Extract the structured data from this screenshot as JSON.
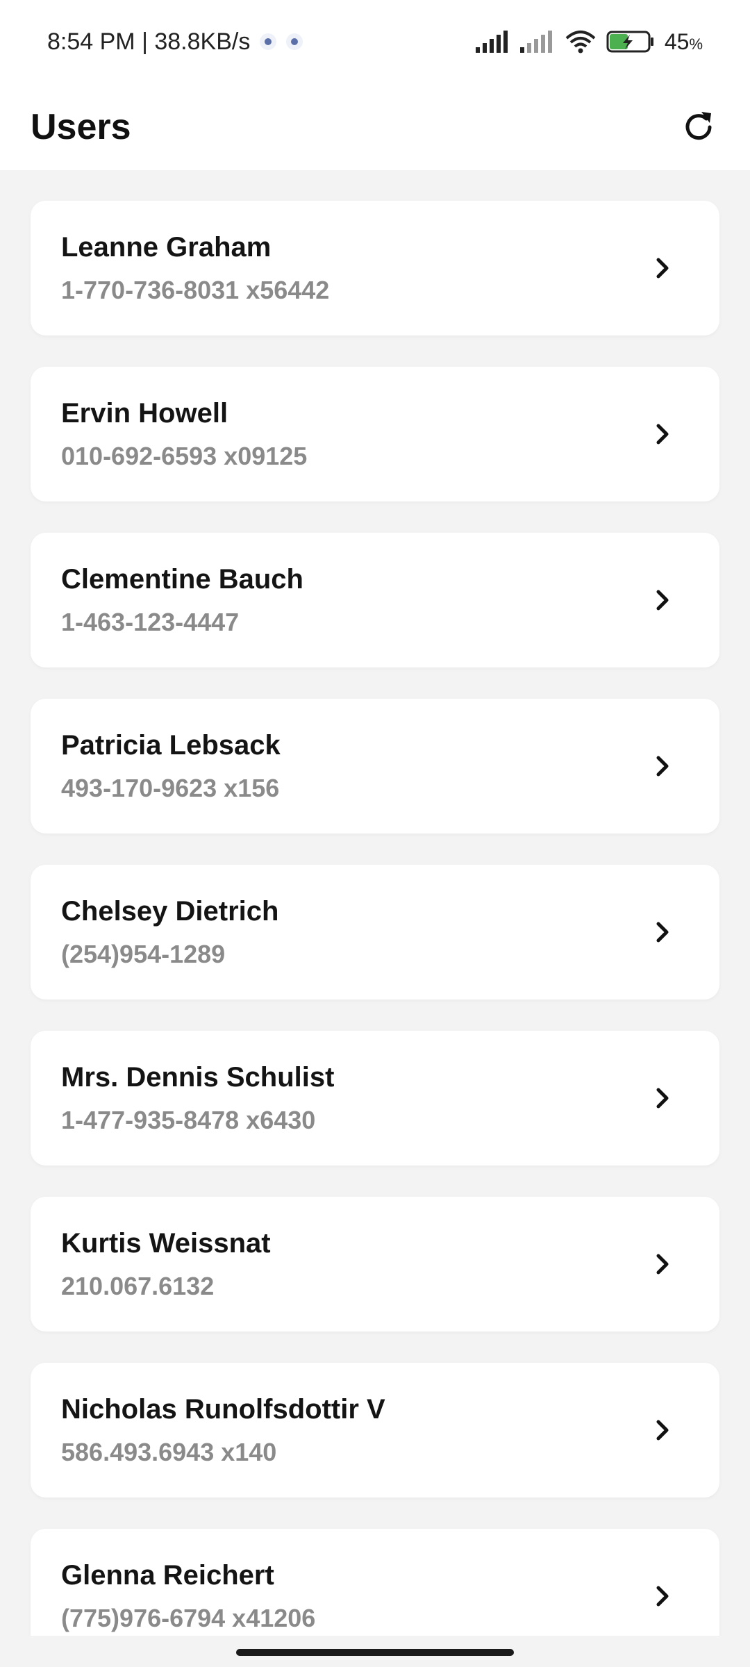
{
  "status_bar": {
    "time_speed": "8:54 PM | 38.8KB/s",
    "battery": "45"
  },
  "app_bar": {
    "title": "Users"
  },
  "users": [
    {
      "name": "Leanne Graham",
      "phone": "1-770-736-8031 x56442"
    },
    {
      "name": "Ervin Howell",
      "phone": "010-692-6593 x09125"
    },
    {
      "name": "Clementine Bauch",
      "phone": "1-463-123-4447"
    },
    {
      "name": "Patricia Lebsack",
      "phone": "493-170-9623 x156"
    },
    {
      "name": "Chelsey Dietrich",
      "phone": "(254)954-1289"
    },
    {
      "name": "Mrs. Dennis Schulist",
      "phone": "1-477-935-8478 x6430"
    },
    {
      "name": "Kurtis Weissnat",
      "phone": "210.067.6132"
    },
    {
      "name": "Nicholas Runolfsdottir V",
      "phone": "586.493.6943 x140"
    },
    {
      "name": "Glenna Reichert",
      "phone": "(775)976-6794 x41206"
    }
  ],
  "icons": {
    "refresh": "refresh-icon",
    "row_chevron": "chevron-right-icon"
  }
}
